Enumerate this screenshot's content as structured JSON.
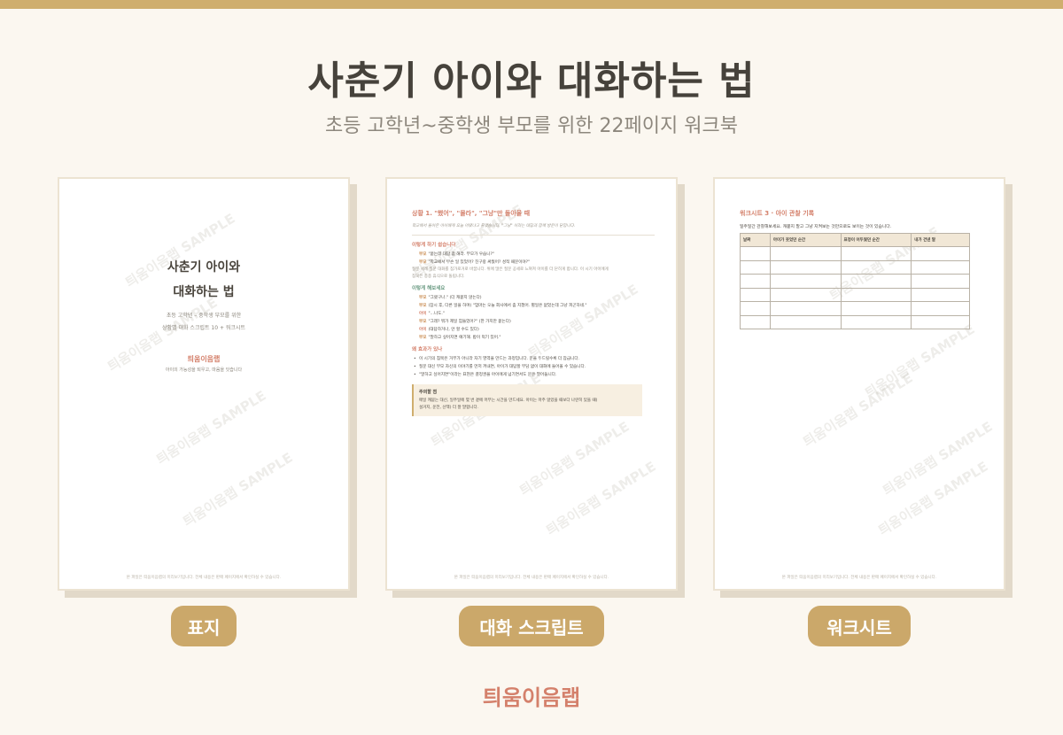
{
  "header": {
    "title": "사춘기 아이와 대화하는 법",
    "subtitle": "초등 고학년~중학생 부모를 위한 22페이지 워크북"
  },
  "watermark": "틔움이음랩 SAMPLE",
  "page_footer": "본 파일은 틔움이음랩의 미리보기입니다. 전체 내용은 판매 페이지에서 확인하실 수 있습니다.",
  "cover": {
    "title_line1": "사춘기 아이와",
    "title_line2": "대화하는 법",
    "sub_line1": "초등 고학년 – 중학생 부모를 위한",
    "sub_line2": "상황별 대화 스크립트 10 + 워크시트",
    "brand": "틔움이음랩",
    "tagline": "아이의 가능성을 틔우고, 마음을 잇습니다"
  },
  "script_page": {
    "title": "상황 1. \"했어\", \"몰라\", \"그냥\"만 돌아올 때",
    "intro": "학교에서 돌아온 아이에게 오늘 어땠냐고 물었습니다. \"그냥\" 이라는 대답과 함께 방문이 닫힙니다.",
    "section1": "이렇게 하기 쉽습니다",
    "wrong_lines": [
      {
        "speaker": "부모",
        "text": "\"묻는데 대답 좀 해라. 부모가 우습니?\""
      },
      {
        "speaker": "부모",
        "text": "\"학교에서 무슨 일 있었어? 친구랑 싸웠어? 성적 때문이야?\""
      }
    ],
    "note_line1": "질문 세례 질문 대화를 침가로거로 바꿉니다. 위에 많은 질문 공세로 느껴져 아이를 더 닫히게 합니다. 이 시기 아이에게",
    "note_line2": "침묵은 종종 휴식으로 돌립니다.",
    "section2": "이렇게 해보세요",
    "right_lines": [
      {
        "speaker": "부모",
        "text": "\"그랬구나.\" (더 캐묻지 않는다)",
        "kid": false
      },
      {
        "speaker": "부모",
        "text": "(잠시 후, 다른 일을 하며) \"엄마는 오늘 회사에서 좀 지쳤어. 별일은 없었는데 그냥 피곤하네.\"",
        "kid": false
      },
      {
        "speaker": "아이",
        "text": "\"...나도.\"",
        "kid": true
      },
      {
        "speaker": "부모",
        "text": "\"그래? 뭐가 제일 힘들었어?\" (한 가지만 묻는다)",
        "kid": false
      },
      {
        "speaker": "아이",
        "text": "(대답하거나, 안 할 수도 있다)",
        "kid": true
      },
      {
        "speaker": "부모",
        "text": "\"말하고 싶어지면 얘기해. 밥이 먹기 있어.\"",
        "kid": false
      }
    ],
    "section3": "왜 효과가 있나",
    "bullets": [
      "이 시기의 침묵은 거부가 아니라 자기 영역을 만드는 과정입니다. 문을 두드릴수록 더 잠급니다.",
      "질문 대신 부모 자신의 이야기를 먼저 꺼내면, 아이가 대답할 부담 없이 대화에 들어올 수 있습니다.",
      "\"말하고 싶어지면\"이라는 표현은 결정권을 아이에게 넘기면서도 문은 열어둡니다."
    ],
    "callout_title": "주의할 점",
    "callout_line1": "매일 캐묻는 대신, 일주일에 몇 번 곁에 머무는 시간을 만드세요. 아이는 마주 앉았을 때보다 나란히 있을 때(",
    "callout_line2": "설거지, 운전, 산책) 더 잘 말합니다."
  },
  "worksheet": {
    "title": "워크시트 3 · 아이 관찰 기록",
    "desc": "일주일간 관찰해보세요. 캐묻지 말고 그냥 지켜보는 것만으로도 보이는 것이 있습니다.",
    "columns": [
      "날짜",
      "아이가 웃었던 순간",
      "표정이 어두웠던 순간",
      "내가 건넨 말"
    ],
    "row_count": 6
  },
  "labels": {
    "cover": "표지",
    "script": "대화 스크립트",
    "worksheet": "워크시트"
  },
  "brand": "틔움이음랩",
  "colors": {
    "accent_gold": "#cfae6e",
    "label_bg": "#cba86a",
    "brand_coral": "#d4806b",
    "section_green": "#6a9a82",
    "background": "#fbf7f0"
  }
}
